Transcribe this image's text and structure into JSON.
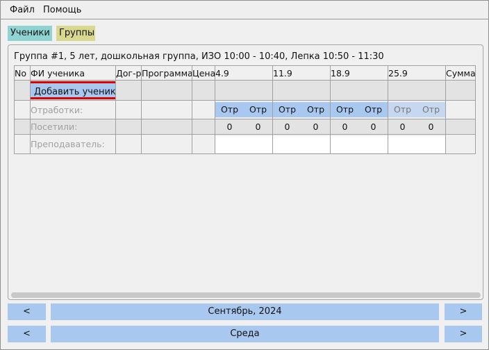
{
  "menu": {
    "file": "Файл",
    "help": "Помощь"
  },
  "tabs": {
    "students": "Ученики",
    "groups": "Группы"
  },
  "group": {
    "title": "Группа #1, 5 лет, дошкольная группа, ИЗО 10:00 - 10:40, Лепка 10:50 - 11:30"
  },
  "table": {
    "headers": {
      "no": "No",
      "name": "ФИ ученика",
      "contract": "Дог-р",
      "program": "Программа",
      "price": "Цена",
      "sum": "Сумма"
    },
    "dates": [
      "4.9",
      "11.9",
      "18.9",
      "25.9"
    ],
    "add_student": "Добавить ученика",
    "row_labels": {
      "makeups": "Отработки:",
      "visited": "Посетили:",
      "teacher": "Преподаватель:"
    },
    "makeup_label": "Отр",
    "visited_values": [
      "0",
      "0",
      "0",
      "0",
      "0",
      "0",
      "0",
      "0"
    ]
  },
  "nav": {
    "month": {
      "prev": "<",
      "label": "Сентябрь, 2024",
      "next": ">"
    },
    "day": {
      "prev": "<",
      "label": "Среда",
      "next": ">"
    }
  },
  "colors": {
    "button": "#a8c8f0",
    "tab_students": "#8fd3d3",
    "tab_groups": "#d8d88e",
    "highlight": "#e00000"
  }
}
